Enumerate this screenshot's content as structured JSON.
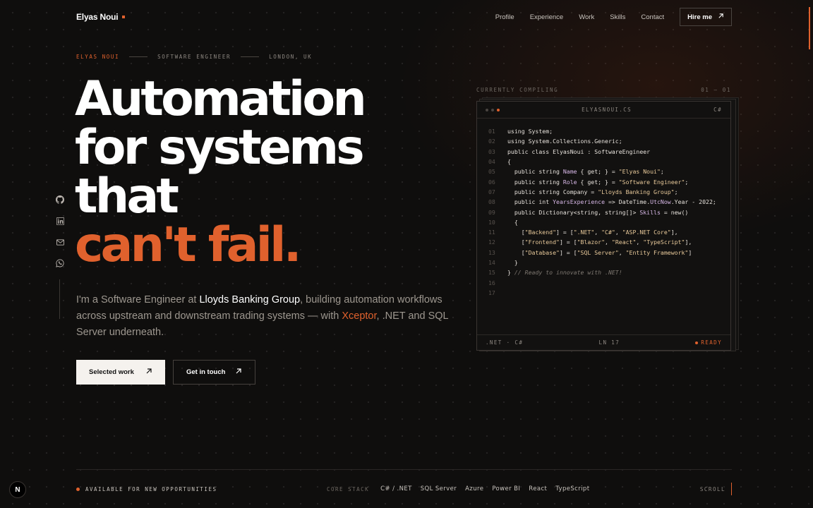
{
  "header": {
    "brand": "Elyas Noui",
    "nav": [
      "Profile",
      "Experience",
      "Work",
      "Skills",
      "Contact"
    ],
    "hire_label": "Hire me"
  },
  "hero": {
    "eyebrow": [
      "ELYAS NOUI",
      "SOFTWARE ENGINEER",
      "LONDON, UK"
    ],
    "headline_lines": [
      "Automation",
      "for systems",
      "that"
    ],
    "headline_accent": "can't fail.",
    "intro": {
      "p1": "I'm a Software Engineer at ",
      "company": "Lloyds Banking Group",
      "p2": ", building automation workflows across upstream and downstream trading systems — with ",
      "tool": "Xceptor",
      "p3": ", .NET and SQL Server underneath."
    },
    "buttons": {
      "primary": "Selected work",
      "secondary": "Get in touch"
    }
  },
  "social": [
    "github-icon",
    "linkedin-icon",
    "mail-icon",
    "whatsapp-icon"
  ],
  "editor": {
    "label": "CURRENTLY COMPILING",
    "counter": "01 — 01",
    "filename": "ELYASNOUI.CS",
    "lang": "C#",
    "footer_left": ".NET · C#",
    "footer_mid": "LN 17",
    "status": "READY",
    "lines": [
      {
        "n": "01",
        "code": "using System;"
      },
      {
        "n": "02",
        "code": "using System.Collections.Generic;"
      },
      {
        "n": "03",
        "code": "public class ElyasNoui : SoftwareEngineer"
      },
      {
        "n": "04",
        "code": "{"
      },
      {
        "n": "05",
        "code": "  public string Name { get; } = \"Elyas Noui\";"
      },
      {
        "n": "06",
        "code": "  public string Role { get; } = \"Software Engineer\";"
      },
      {
        "n": "07",
        "code": "  public string Company = \"Lloyds Banking Group\";"
      },
      {
        "n": "08",
        "code": "  public int YearsExperience => DateTime.UtcNow.Year - 2022;"
      },
      {
        "n": "09",
        "code": "  public Dictionary<string, string[]> Skills = new()"
      },
      {
        "n": "10",
        "code": "  {"
      },
      {
        "n": "11",
        "code": "    [\"Backend\"] = [\".NET\", \"C#\", \"ASP.NET Core\"],"
      },
      {
        "n": "12",
        "code": "    [\"Frontend\"] = [\"Blazor\", \"React\", \"TypeScript\"],"
      },
      {
        "n": "13",
        "code": "    [\"Database\"] = [\"SQL Server\", \"Entity Framework\"]"
      },
      {
        "n": "14",
        "code": "  }"
      },
      {
        "n": "15",
        "code": "} // Ready to innovate with .NET!"
      },
      {
        "n": "16",
        "code": ""
      },
      {
        "n": "17",
        "code": ""
      }
    ]
  },
  "footer": {
    "availability": "AVAILABLE FOR NEW OPPORTUNITIES",
    "stack_label": "CORE STACK",
    "stack": [
      "C# / .NET",
      "SQL Server",
      "Azure",
      "Power BI",
      "React",
      "TypeScript"
    ],
    "scroll": "SCROLL"
  },
  "badge": "N",
  "colors": {
    "accent": "#e0612d",
    "background": "#0f0e0d",
    "text": "#e8e4df"
  }
}
